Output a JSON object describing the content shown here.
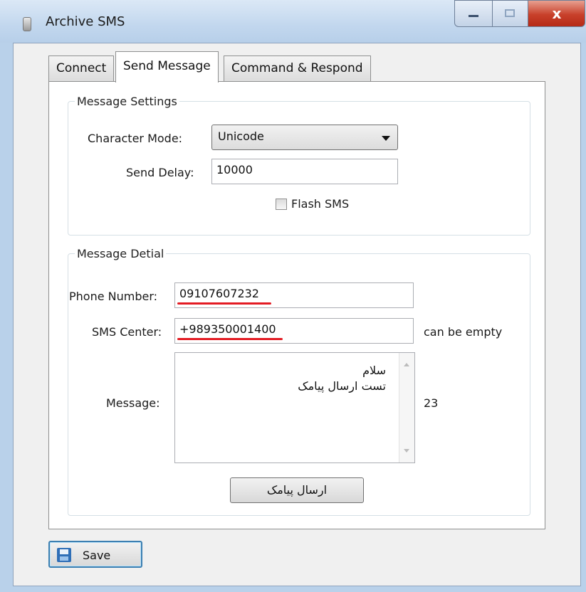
{
  "window": {
    "title": "Archive SMS"
  },
  "tabs": [
    {
      "label": "Connect",
      "active": false
    },
    {
      "label": "Send Message",
      "active": true
    },
    {
      "label": "Command & Respond",
      "active": false
    }
  ],
  "message_settings": {
    "legend": "Message Settings",
    "character_mode": {
      "label": "Character Mode:",
      "value": "Unicode"
    },
    "send_delay": {
      "label": "Send Delay:",
      "value": "10000"
    },
    "flash_sms": {
      "label": "Flash SMS",
      "checked": false
    }
  },
  "message_detail": {
    "legend": "Message Detial",
    "phone_number": {
      "label": "Phone Number:",
      "value": "09107607232"
    },
    "sms_center": {
      "label": "SMS Center:",
      "value": "+989350001400",
      "hint": "can be empty"
    },
    "message": {
      "label": "Message:",
      "value": "سلام\nتست ارسال پیامک",
      "count": "23"
    },
    "send_button": "ارسال پیامک"
  },
  "save_button": "Save",
  "colors": {
    "underline": "#e31b23",
    "close_button": "#c8402a",
    "accent": "#3c7fb1"
  },
  "icons": [
    "app-icon",
    "minimize-icon",
    "maximize-icon",
    "close-icon",
    "save-floppy-icon"
  ]
}
